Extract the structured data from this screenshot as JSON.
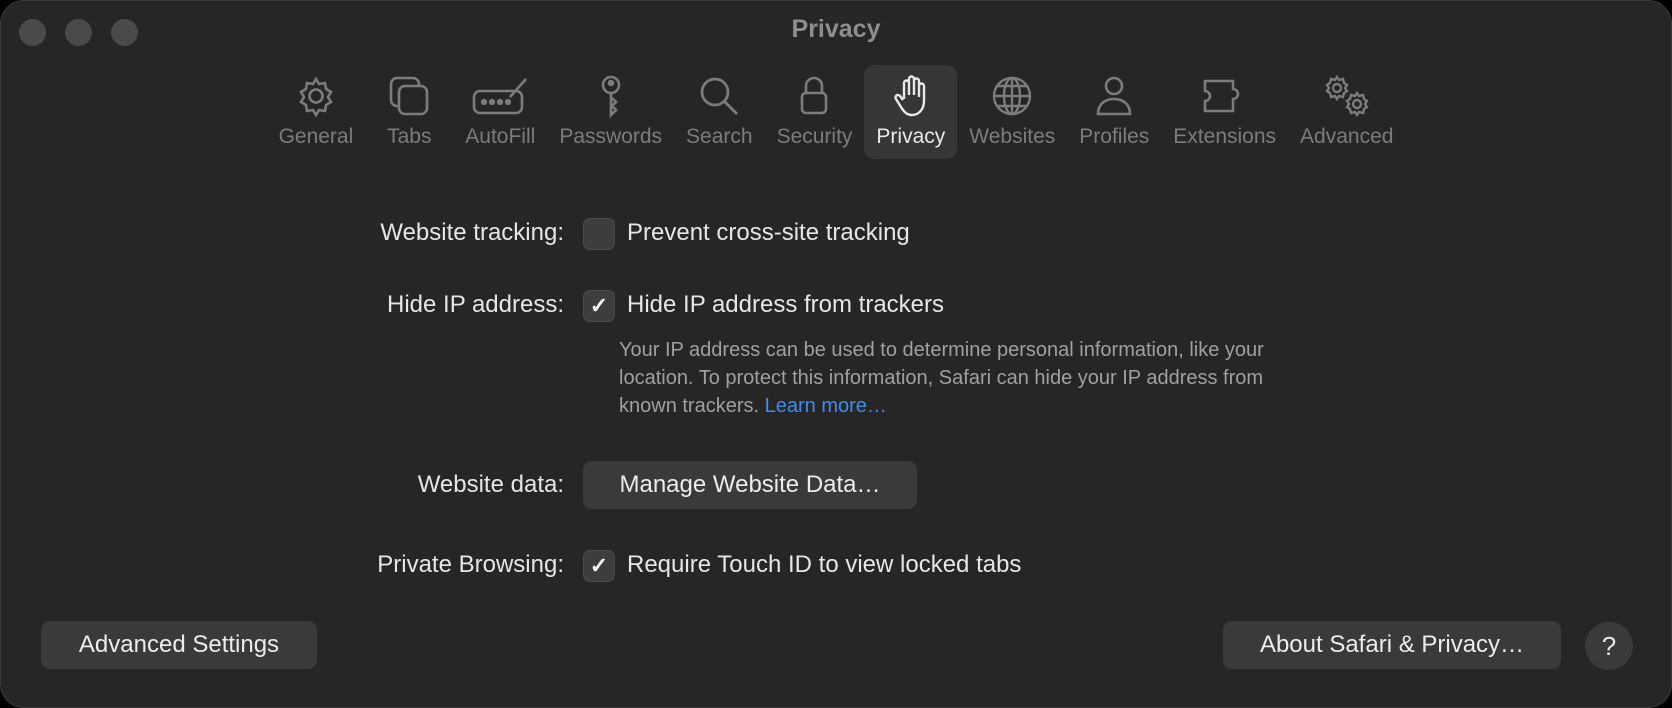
{
  "window": {
    "title": "Privacy"
  },
  "toolbar": {
    "items": [
      {
        "label": "General",
        "icon": "gear-icon"
      },
      {
        "label": "Tabs",
        "icon": "tabs-icon"
      },
      {
        "label": "AutoFill",
        "icon": "autofill-icon"
      },
      {
        "label": "Passwords",
        "icon": "key-icon"
      },
      {
        "label": "Search",
        "icon": "magnifier-icon"
      },
      {
        "label": "Security",
        "icon": "lock-icon"
      },
      {
        "label": "Privacy",
        "icon": "hand-icon",
        "selected": true
      },
      {
        "label": "Websites",
        "icon": "globe-icon"
      },
      {
        "label": "Profiles",
        "icon": "person-icon"
      },
      {
        "label": "Extensions",
        "icon": "puzzle-icon"
      },
      {
        "label": "Advanced",
        "icon": "gears-icon"
      }
    ]
  },
  "settings": {
    "tracking": {
      "label": "Website tracking:",
      "option": "Prevent cross-site tracking",
      "checked": false
    },
    "hide_ip": {
      "label": "Hide IP address:",
      "option": "Hide IP address from trackers",
      "checked": true,
      "description": "Your IP address can be used to determine personal information, like your location. To protect this information, Safari can hide your IP address from known trackers.",
      "link": "Learn more…"
    },
    "website_data": {
      "label": "Website data:",
      "button": "Manage Website Data…"
    },
    "private_browsing": {
      "label": "Private Browsing:",
      "option": "Require Touch ID to view locked tabs",
      "checked": true
    }
  },
  "footer": {
    "advanced_button": "Advanced Settings",
    "about_button": "About Safari & Privacy…",
    "help_button": "?"
  },
  "colors": {
    "window_bg": "#262626",
    "link": "#3b8ef0",
    "selected_tab_bg": "#363636"
  }
}
